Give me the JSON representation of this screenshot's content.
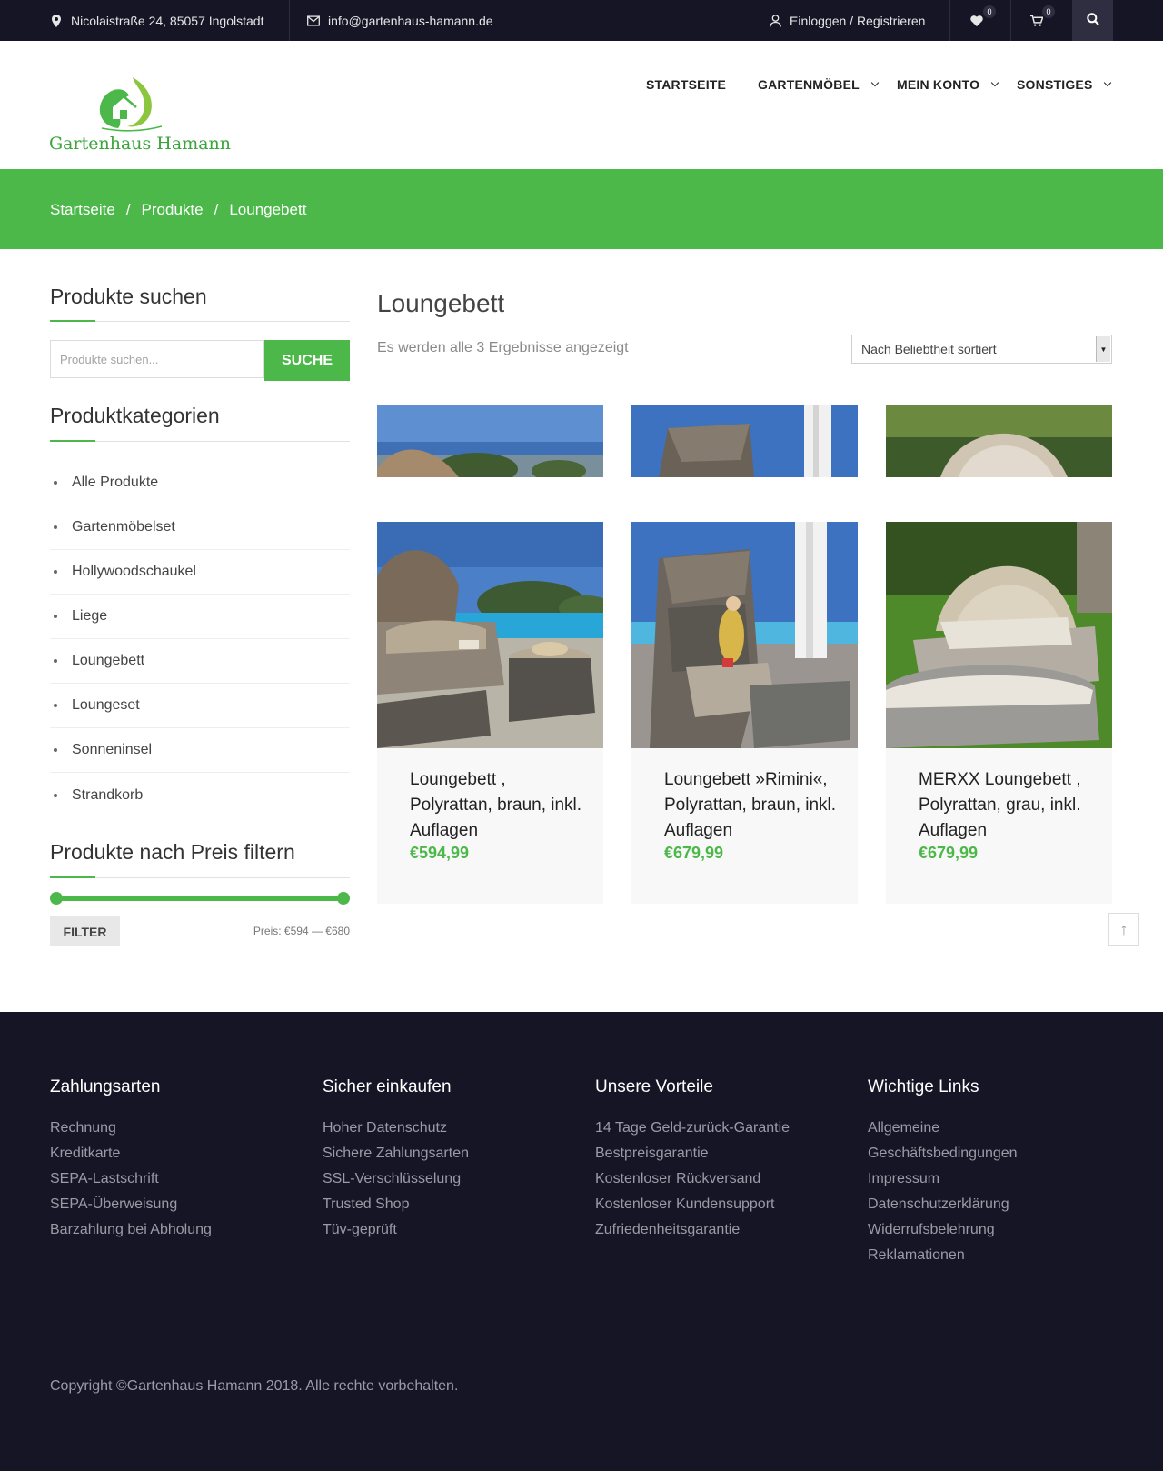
{
  "topbar": {
    "address": "Nicolaistraße 24, 85057 Ingolstadt",
    "email": "info@gartenhaus-hamann.de",
    "login": "Einloggen / Registrieren",
    "wishlist_count": "0",
    "cart_count": "0"
  },
  "logo": {
    "text": "Gartenhaus Hamann"
  },
  "nav": {
    "items": [
      {
        "label": "STARTSEITE"
      },
      {
        "label": "GARTENMÖBEL"
      },
      {
        "label": "MEIN KONTO"
      },
      {
        "label": "SONSTIGES"
      }
    ]
  },
  "breadcrumb": {
    "items": [
      "Startseite",
      "Produkte",
      "Loungebett"
    ],
    "separator": "/"
  },
  "sidebar": {
    "search_title": "Produkte suchen",
    "search_placeholder": "Produkte suchen...",
    "search_button": "SUCHE",
    "categories_title": "Produktkategorien",
    "categories": [
      "Alle Produkte",
      "Gartenmöbelset",
      "Hollywoodschaukel",
      "Liege",
      "Loungebett",
      "Loungeset",
      "Sonneninsel",
      "Strandkorb"
    ],
    "price_title": "Produkte nach Preis filtern",
    "filter_button": "FILTER",
    "price_range_text": "Preis: €594 — €680",
    "price_min": 594,
    "price_max": 680
  },
  "main": {
    "title": "Loungebett",
    "result_count": "Es werden alle 3 Ergebnisse angezeigt",
    "sort_selected": "Nach Beliebtheit sortiert",
    "products": [
      {
        "name": "Loungebett , Polyrattan, braun, inkl. Auflagen",
        "price": "€594,99"
      },
      {
        "name": "Loungebett »Rimini«, Polyrattan, braun, inkl. Auflagen",
        "price": "€679,99"
      },
      {
        "name": "MERXX Loungebett , Polyrattan, grau, inkl. Auflagen",
        "price": "€679,99"
      }
    ]
  },
  "footer": {
    "columns": [
      {
        "title": "Zahlungsarten",
        "links": [
          "Rechnung",
          "Kreditkarte",
          "SEPA-Lastschrift",
          "SEPA-Überweisung",
          "Barzahlung bei Abholung"
        ]
      },
      {
        "title": "Sicher einkaufen",
        "links": [
          "Hoher Datenschutz",
          "Sichere Zahlungsarten",
          "SSL-Verschlüsselung",
          "Trusted Shop",
          "Tüv-geprüft"
        ]
      },
      {
        "title": "Unsere Vorteile",
        "links": [
          "14 Tage Geld-zurück-Garantie",
          "Bestpreisgarantie",
          "Kostenloser Rückversand",
          "Kostenloser Kundensupport",
          "Zufriedenheitsgarantie"
        ]
      },
      {
        "title": "Wichtige Links",
        "links": [
          "Allgemeine",
          "Geschäftsbedingungen",
          "Impressum",
          "Datenschutzerklärung",
          "Widerrufsbelehrung",
          "Reklamationen"
        ]
      }
    ],
    "copyright": "Copyright ©Gartenhaus Hamann 2018. Alle rechte vorbehalten."
  },
  "colors": {
    "brand_green": "#4cb849",
    "dark_bg": "#151526",
    "price_green": "#4cb849"
  }
}
